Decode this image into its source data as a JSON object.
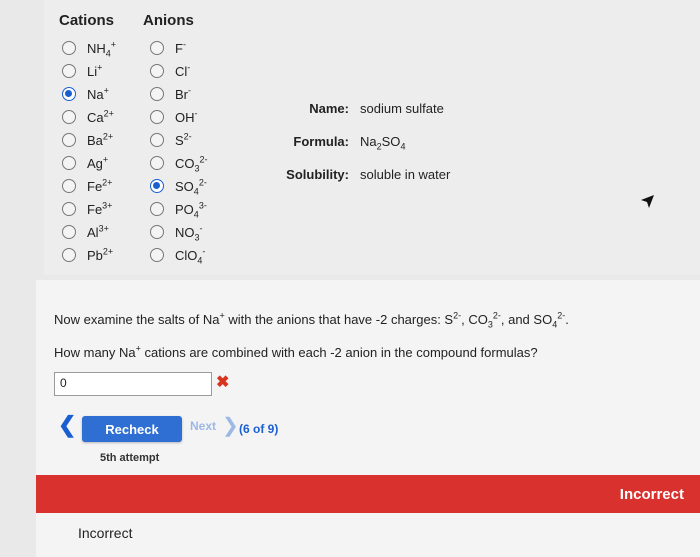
{
  "cations_header": "Cations",
  "anions_header": "Anions",
  "cations": [
    {
      "base": "NH",
      "sub": "4",
      "sup": "+",
      "checked": false
    },
    {
      "base": "Li",
      "sub": "",
      "sup": "+",
      "checked": false
    },
    {
      "base": "Na",
      "sub": "",
      "sup": "+",
      "checked": true
    },
    {
      "base": "Ca",
      "sub": "",
      "sup": "2+",
      "checked": false
    },
    {
      "base": "Ba",
      "sub": "",
      "sup": "2+",
      "checked": false
    },
    {
      "base": "Ag",
      "sub": "",
      "sup": "+",
      "checked": false
    },
    {
      "base": "Fe",
      "sub": "",
      "sup": "2+",
      "checked": false
    },
    {
      "base": "Fe",
      "sub": "",
      "sup": "3+",
      "checked": false
    },
    {
      "base": "Al",
      "sub": "",
      "sup": "3+",
      "checked": false
    },
    {
      "base": "Pb",
      "sub": "",
      "sup": "2+",
      "checked": false
    }
  ],
  "anions": [
    {
      "base": "F",
      "sub": "",
      "sup": "-",
      "checked": false
    },
    {
      "base": "Cl",
      "sub": "",
      "sup": "-",
      "checked": false
    },
    {
      "base": "Br",
      "sub": "",
      "sup": "-",
      "checked": false
    },
    {
      "base": "OH",
      "sub": "",
      "sup": "-",
      "checked": false
    },
    {
      "base": "S",
      "sub": "",
      "sup": "2-",
      "checked": false
    },
    {
      "base": "CO",
      "sub": "3",
      "sup": "2-",
      "checked": false
    },
    {
      "base": "SO",
      "sub": "4",
      "sup": "2-",
      "checked": true
    },
    {
      "base": "PO",
      "sub": "4",
      "sup": "3-",
      "checked": false
    },
    {
      "base": "NO",
      "sub": "3",
      "sup": "-",
      "checked": false
    },
    {
      "base": "ClO",
      "sub": "4",
      "sup": "-",
      "checked": false
    }
  ],
  "info": {
    "name_label": "Name:",
    "name_value": "sodium sulfate",
    "formula_label": "Formula:",
    "formula_na": "Na",
    "formula_na_sub": "2",
    "formula_so": "SO",
    "formula_so_sub": "4",
    "solubility_label": "Solubility:",
    "solubility_value": "soluble in water"
  },
  "question": {
    "line1_a": "Now examine the salts of Na",
    "line1_sup": "+",
    "line1_b": " with the anions that have -2 charges: S",
    "line1_s_sup": "2-",
    "line1_c": ", CO",
    "line1_co_sub": "3",
    "line1_co_sup": "2-",
    "line1_d": ", and SO",
    "line1_so_sub": "4",
    "line1_so_sup": "2-",
    "line1_e": ".",
    "line2_a": "How many Na",
    "line2_sup": "+",
    "line2_b": " cations are combined with each -2 anion in the compound formulas?"
  },
  "answer_value": "0",
  "wrong_mark": "✖",
  "back_arrow": "❮",
  "recheck_label": "Recheck",
  "next_label": "Next",
  "next_chevron": "❯",
  "progress": "(6 of 9)",
  "attempt_text": "5th attempt",
  "banner_text": "Incorrect",
  "feedback_text": "Incorrect",
  "colors": {
    "accent": "#2f6fd3",
    "error": "#d9312d",
    "selected_radio": "#1a5fd0"
  }
}
